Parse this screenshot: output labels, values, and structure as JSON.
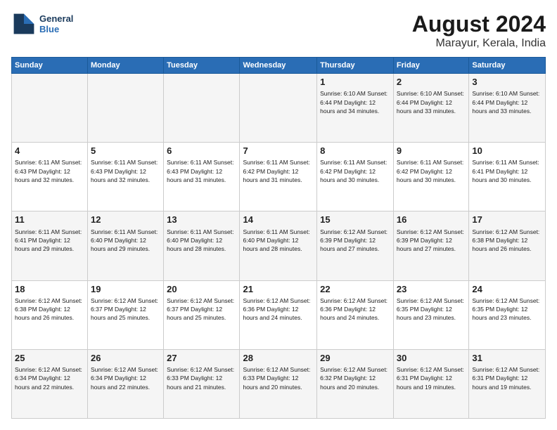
{
  "logo": {
    "line1": "General",
    "line2": "Blue"
  },
  "title": "August 2024",
  "location": "Marayur, Kerala, India",
  "days_of_week": [
    "Sunday",
    "Monday",
    "Tuesday",
    "Wednesday",
    "Thursday",
    "Friday",
    "Saturday"
  ],
  "weeks": [
    [
      {
        "day": "",
        "info": ""
      },
      {
        "day": "",
        "info": ""
      },
      {
        "day": "",
        "info": ""
      },
      {
        "day": "",
        "info": ""
      },
      {
        "day": "1",
        "info": "Sunrise: 6:10 AM\nSunset: 6:44 PM\nDaylight: 12 hours\nand 34 minutes."
      },
      {
        "day": "2",
        "info": "Sunrise: 6:10 AM\nSunset: 6:44 PM\nDaylight: 12 hours\nand 33 minutes."
      },
      {
        "day": "3",
        "info": "Sunrise: 6:10 AM\nSunset: 6:44 PM\nDaylight: 12 hours\nand 33 minutes."
      }
    ],
    [
      {
        "day": "4",
        "info": "Sunrise: 6:11 AM\nSunset: 6:43 PM\nDaylight: 12 hours\nand 32 minutes."
      },
      {
        "day": "5",
        "info": "Sunrise: 6:11 AM\nSunset: 6:43 PM\nDaylight: 12 hours\nand 32 minutes."
      },
      {
        "day": "6",
        "info": "Sunrise: 6:11 AM\nSunset: 6:43 PM\nDaylight: 12 hours\nand 31 minutes."
      },
      {
        "day": "7",
        "info": "Sunrise: 6:11 AM\nSunset: 6:42 PM\nDaylight: 12 hours\nand 31 minutes."
      },
      {
        "day": "8",
        "info": "Sunrise: 6:11 AM\nSunset: 6:42 PM\nDaylight: 12 hours\nand 30 minutes."
      },
      {
        "day": "9",
        "info": "Sunrise: 6:11 AM\nSunset: 6:42 PM\nDaylight: 12 hours\nand 30 minutes."
      },
      {
        "day": "10",
        "info": "Sunrise: 6:11 AM\nSunset: 6:41 PM\nDaylight: 12 hours\nand 30 minutes."
      }
    ],
    [
      {
        "day": "11",
        "info": "Sunrise: 6:11 AM\nSunset: 6:41 PM\nDaylight: 12 hours\nand 29 minutes."
      },
      {
        "day": "12",
        "info": "Sunrise: 6:11 AM\nSunset: 6:40 PM\nDaylight: 12 hours\nand 29 minutes."
      },
      {
        "day": "13",
        "info": "Sunrise: 6:11 AM\nSunset: 6:40 PM\nDaylight: 12 hours\nand 28 minutes."
      },
      {
        "day": "14",
        "info": "Sunrise: 6:11 AM\nSunset: 6:40 PM\nDaylight: 12 hours\nand 28 minutes."
      },
      {
        "day": "15",
        "info": "Sunrise: 6:12 AM\nSunset: 6:39 PM\nDaylight: 12 hours\nand 27 minutes."
      },
      {
        "day": "16",
        "info": "Sunrise: 6:12 AM\nSunset: 6:39 PM\nDaylight: 12 hours\nand 27 minutes."
      },
      {
        "day": "17",
        "info": "Sunrise: 6:12 AM\nSunset: 6:38 PM\nDaylight: 12 hours\nand 26 minutes."
      }
    ],
    [
      {
        "day": "18",
        "info": "Sunrise: 6:12 AM\nSunset: 6:38 PM\nDaylight: 12 hours\nand 26 minutes."
      },
      {
        "day": "19",
        "info": "Sunrise: 6:12 AM\nSunset: 6:37 PM\nDaylight: 12 hours\nand 25 minutes."
      },
      {
        "day": "20",
        "info": "Sunrise: 6:12 AM\nSunset: 6:37 PM\nDaylight: 12 hours\nand 25 minutes."
      },
      {
        "day": "21",
        "info": "Sunrise: 6:12 AM\nSunset: 6:36 PM\nDaylight: 12 hours\nand 24 minutes."
      },
      {
        "day": "22",
        "info": "Sunrise: 6:12 AM\nSunset: 6:36 PM\nDaylight: 12 hours\nand 24 minutes."
      },
      {
        "day": "23",
        "info": "Sunrise: 6:12 AM\nSunset: 6:35 PM\nDaylight: 12 hours\nand 23 minutes."
      },
      {
        "day": "24",
        "info": "Sunrise: 6:12 AM\nSunset: 6:35 PM\nDaylight: 12 hours\nand 23 minutes."
      }
    ],
    [
      {
        "day": "25",
        "info": "Sunrise: 6:12 AM\nSunset: 6:34 PM\nDaylight: 12 hours\nand 22 minutes."
      },
      {
        "day": "26",
        "info": "Sunrise: 6:12 AM\nSunset: 6:34 PM\nDaylight: 12 hours\nand 22 minutes."
      },
      {
        "day": "27",
        "info": "Sunrise: 6:12 AM\nSunset: 6:33 PM\nDaylight: 12 hours\nand 21 minutes."
      },
      {
        "day": "28",
        "info": "Sunrise: 6:12 AM\nSunset: 6:33 PM\nDaylight: 12 hours\nand 20 minutes."
      },
      {
        "day": "29",
        "info": "Sunrise: 6:12 AM\nSunset: 6:32 PM\nDaylight: 12 hours\nand 20 minutes."
      },
      {
        "day": "30",
        "info": "Sunrise: 6:12 AM\nSunset: 6:31 PM\nDaylight: 12 hours\nand 19 minutes."
      },
      {
        "day": "31",
        "info": "Sunrise: 6:12 AM\nSunset: 6:31 PM\nDaylight: 12 hours\nand 19 minutes."
      }
    ]
  ]
}
